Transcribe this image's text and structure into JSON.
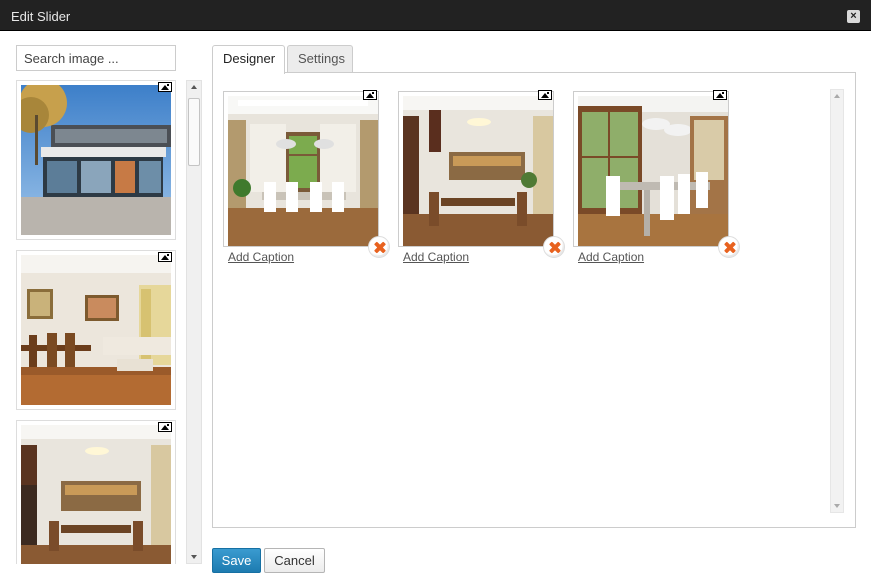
{
  "window": {
    "title": "Edit Slider",
    "close_glyph": "×"
  },
  "search": {
    "placeholder": "Search image ..."
  },
  "library": {
    "items": [
      {
        "name": "modern-building-exterior",
        "icon": "image-icon"
      },
      {
        "name": "living-dining-room",
        "icon": "image-icon"
      },
      {
        "name": "dining-kitchen-stairs",
        "icon": "image-icon"
      }
    ]
  },
  "tabs": [
    {
      "label": "Designer",
      "active": true
    },
    {
      "label": "Settings",
      "active": false
    }
  ],
  "slides": [
    {
      "caption_link": "Add Caption",
      "icon": "image-icon"
    },
    {
      "caption_link": "Add Caption",
      "icon": "image-icon"
    },
    {
      "caption_link": "Add Caption",
      "icon": "image-icon"
    }
  ],
  "buttons": {
    "save": "Save",
    "cancel": "Cancel"
  },
  "colors": {
    "titlebar": "#222222",
    "primary_button": "#2589c0",
    "remove_icon": "#e8621f"
  }
}
